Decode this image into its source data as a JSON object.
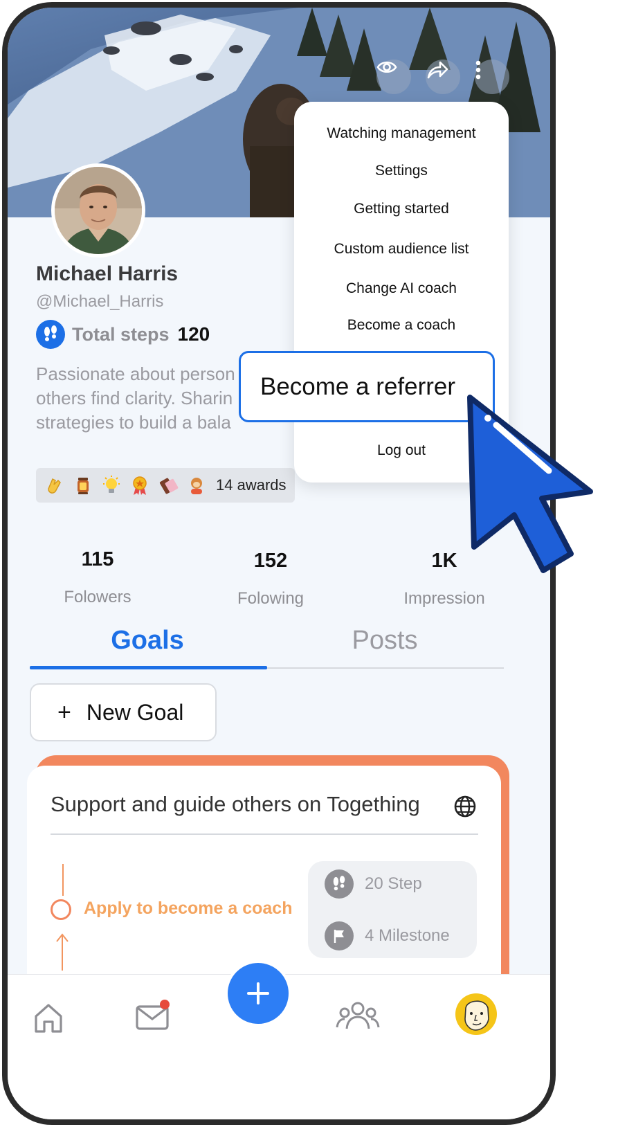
{
  "profile": {
    "name": "Michael Harris",
    "handle": "@Michael_Harris",
    "steps_label": "Total steps",
    "steps_value": "120",
    "bio_lines": [
      "Passionate about person",
      "others find clarity. Sharin",
      "strategies to build a bala"
    ],
    "awards_label": "14 awards"
  },
  "stats": [
    {
      "value": "115",
      "label": "Folowers"
    },
    {
      "value": "152",
      "label": "Folowing"
    },
    {
      "value": "1K",
      "label": "Impression"
    }
  ],
  "tabs": {
    "goals": "Goals",
    "posts": "Posts"
  },
  "new_goal_label": "New Goal",
  "goal_card": {
    "title": "Support and guide others on Togething",
    "item": "Apply to become a coach",
    "steps": "20 Step",
    "milestones": "4 Milestone"
  },
  "menu": {
    "items": [
      "Watching management",
      "Settings",
      "Getting started",
      "Custom audience list",
      "Change AI coach",
      "Become a coach"
    ],
    "highlighted": "Become a referrer",
    "logout": "Log out"
  },
  "colors": {
    "accent": "#1c6fe6",
    "goal_accent": "#f2875e",
    "fab": "#2d7ef5"
  },
  "icons": [
    "eye-icon",
    "share-icon",
    "more-icon",
    "footsteps-icon",
    "globe-icon",
    "flag-icon",
    "home-icon",
    "mail-icon",
    "plus-icon",
    "people-icon",
    "ai-coach-icon",
    "cursor-icon"
  ]
}
